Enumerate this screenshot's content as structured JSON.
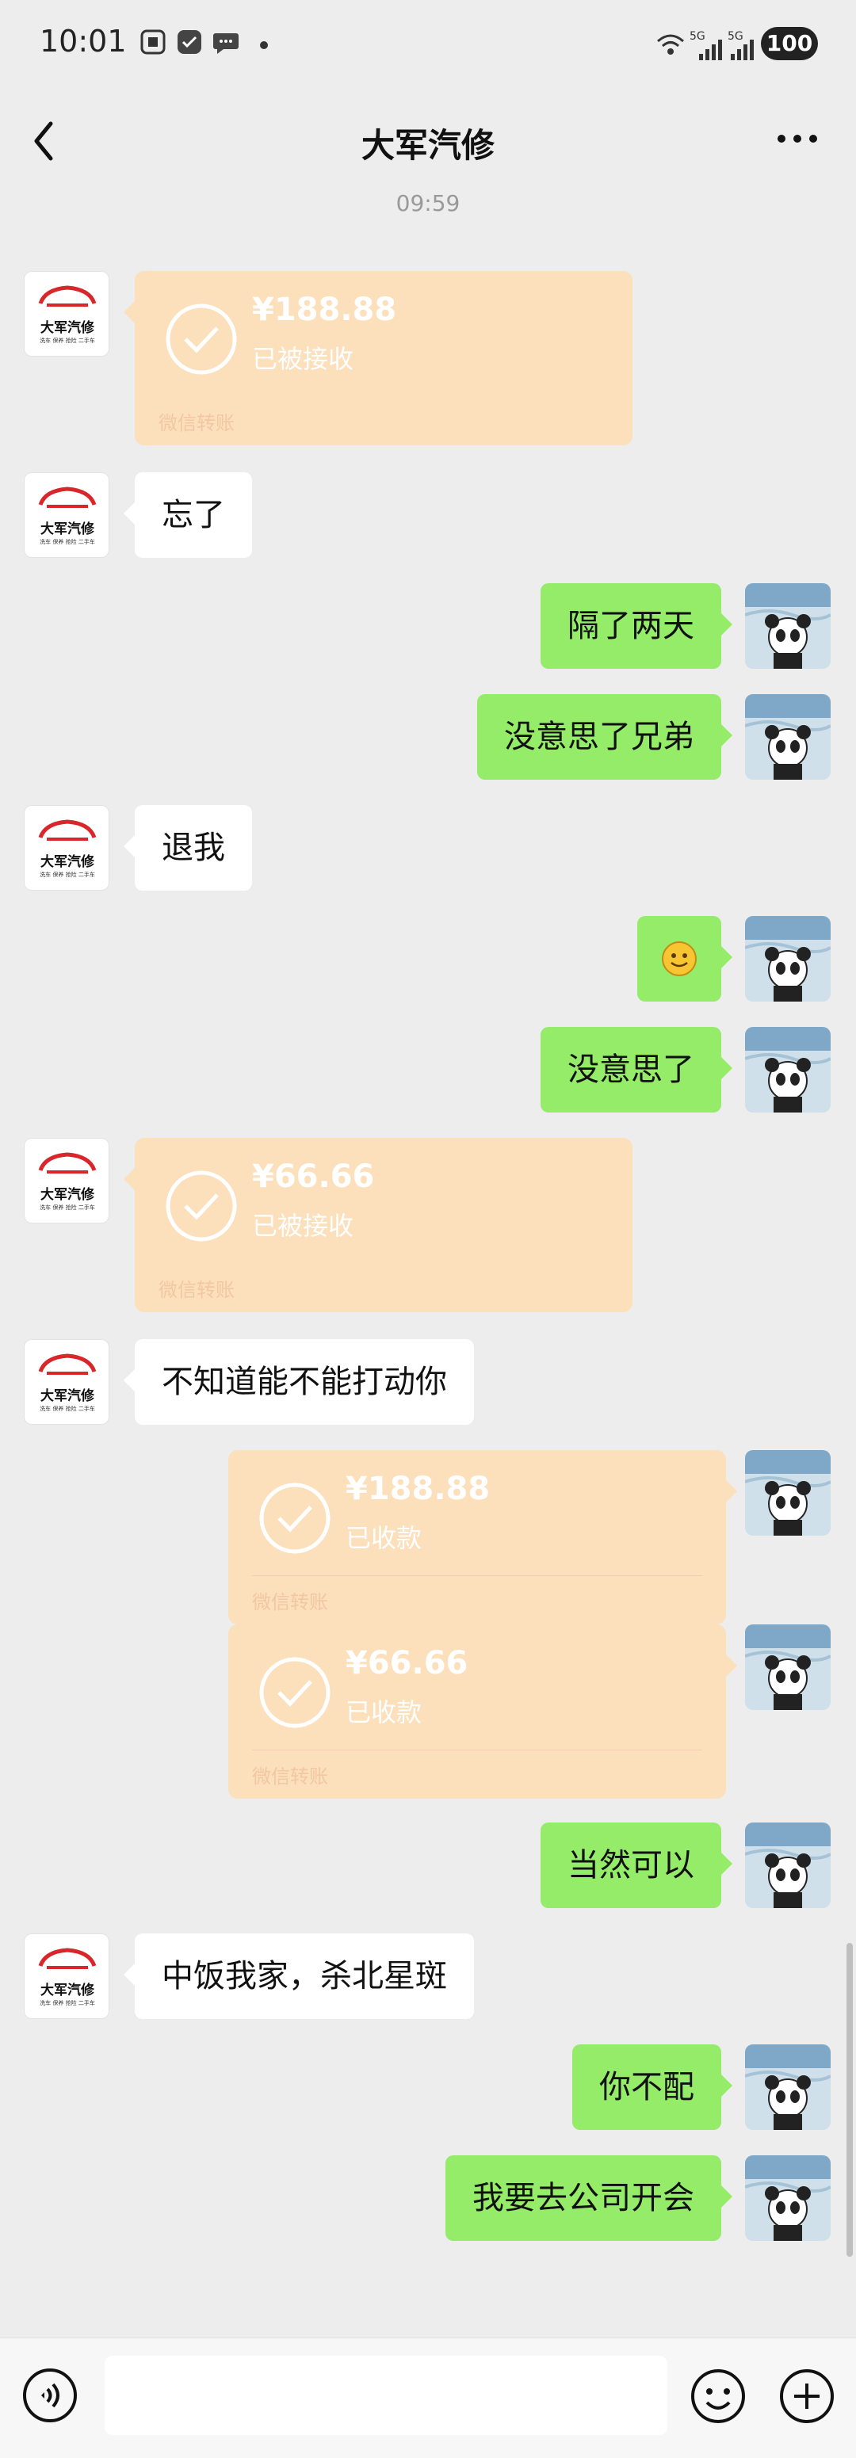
{
  "status_bar": {
    "time": "10:01",
    "battery": "100",
    "network_label": "5G"
  },
  "header": {
    "title": "大军汽修",
    "back_icon": "chevron-left-icon",
    "more_icon": "more-dots-icon"
  },
  "timestamp": "09:59",
  "contact_avatar": {
    "name": "大军汽修",
    "subtitle": "洗车 保养 抢险 二手车"
  },
  "messages": [
    {
      "side": "left",
      "kind": "transfer",
      "amount": "¥188.88",
      "status": "已被接收",
      "footer": "微信转账"
    },
    {
      "side": "left",
      "kind": "text",
      "text": "忘了"
    },
    {
      "side": "right",
      "kind": "text",
      "text": "隔了两天"
    },
    {
      "side": "right",
      "kind": "text",
      "text": "没意思了兄弟"
    },
    {
      "side": "left",
      "kind": "text",
      "text": "退我"
    },
    {
      "side": "right",
      "kind": "emoji",
      "icon": "smile-emoji-icon"
    },
    {
      "side": "right",
      "kind": "text",
      "text": "没意思了"
    },
    {
      "side": "left",
      "kind": "transfer",
      "amount": "¥66.66",
      "status": "已被接收",
      "footer": "微信转账"
    },
    {
      "side": "left",
      "kind": "text",
      "text": "不知道能不能打动你"
    },
    {
      "side": "right",
      "kind": "transfer",
      "amount": "¥188.88",
      "status": "已收款",
      "footer": "微信转账"
    },
    {
      "side": "right",
      "kind": "transfer",
      "amount": "¥66.66",
      "status": "已收款",
      "footer": "微信转账"
    },
    {
      "side": "right",
      "kind": "text",
      "text": "当然可以"
    },
    {
      "side": "left",
      "kind": "text",
      "text": "中饭我家，杀北星斑"
    },
    {
      "side": "right",
      "kind": "text",
      "text": "你不配"
    },
    {
      "side": "right",
      "kind": "text",
      "text": "我要去公司开会"
    }
  ],
  "input_bar": {
    "placeholder": "",
    "voice_icon": "voice-icon",
    "emoji_icon": "emoji-icon",
    "plus_icon": "plus-icon"
  },
  "colors": {
    "background": "#ededed",
    "bubble_mine": "#95ec69",
    "bubble_theirs": "#ffffff",
    "transfer_card": "#fcdfbb"
  }
}
